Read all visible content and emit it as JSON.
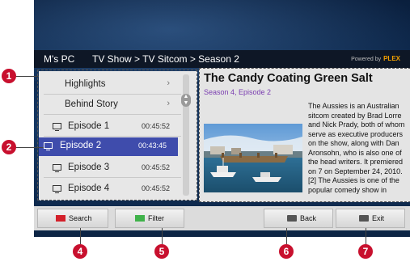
{
  "header": {
    "source": "M's PC",
    "breadcrumb": "TV Show > TV Sitcom > Season 2",
    "brand_prefix": "Powered by",
    "brand_name": "PLEX"
  },
  "list": {
    "items": [
      {
        "label": "Highlights",
        "type": "folder"
      },
      {
        "label": "Behind Story",
        "type": "folder"
      },
      {
        "label": "Episode 1",
        "duration": "00:45:52"
      },
      {
        "label": "Episode 2",
        "duration": "00:43:45",
        "selected": true
      },
      {
        "label": "Episode 3",
        "duration": "00:45:52"
      },
      {
        "label": "Episode 4",
        "duration": "00:45:52"
      }
    ]
  },
  "detail": {
    "title": "The Candy Coating Green Salt",
    "subtitle": "Season 4, Episode 2",
    "description": "The Aussies is an Australian sitcom created by Brad Lorre and Nick Prady, both of whom serve as executive producers on the show, along with Dan Aronsohn, who is also one of the head writers. It premiered on 7 on September 24, 2010.[2] The Aussies is one of the popular comedy show in"
  },
  "buttons": {
    "search": "Search",
    "filter": "Filter",
    "back": "Back",
    "exit": "Exit"
  },
  "colors": {
    "search": "#d3202a",
    "filter": "#3fb24a",
    "selected": "#3f4cac",
    "callout": "#c8102e"
  },
  "callouts": [
    "1",
    "2",
    "4",
    "5",
    "6",
    "7"
  ]
}
